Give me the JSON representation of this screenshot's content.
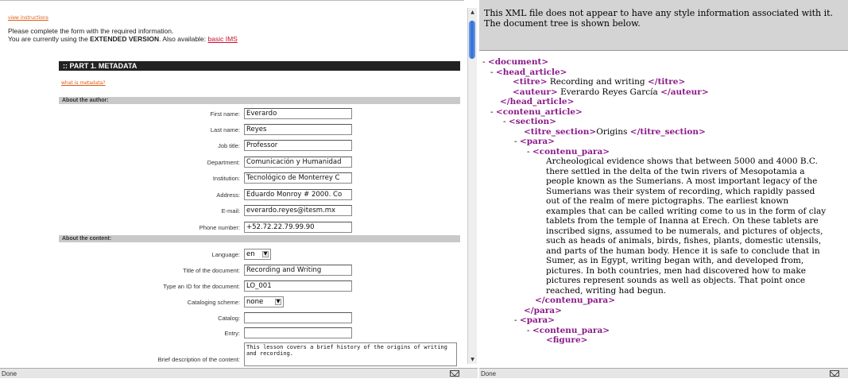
{
  "left": {
    "view_instructions": "view instructions",
    "intro_line1": "Please complete the form with the required information.",
    "intro_line2_prefix": "You are currently using the ",
    "intro_line2_version": "EXTENDED VERSION",
    "intro_line2_mid": ". Also available: ",
    "intro_line2_link": "basic IMS",
    "part_title": ":: PART 1. METADATA",
    "what_is_metadata": "what is metadata?",
    "section_author": "About the author:",
    "section_content": "About the content:",
    "author_fields": [
      {
        "label": "First name:",
        "value": "Everardo"
      },
      {
        "label": "Last name:",
        "value": "Reyes"
      },
      {
        "label": "Job title:",
        "value": "Professor"
      },
      {
        "label": "Department:",
        "value": "Comunicación y Humanidad"
      },
      {
        "label": "Institution:",
        "value": "Tecnológico de Monterrey C"
      },
      {
        "label": "Address:",
        "value": "Eduardo Monroy # 2000. Co"
      },
      {
        "label": "E-mail:",
        "value": "everardo.reyes@itesm.mx"
      },
      {
        "label": "Phone number:",
        "value": "+52.72.22.79.99.90"
      }
    ],
    "language_label": "Language:",
    "language_value": "en",
    "doc_title_label": "Title of the document:",
    "doc_title_value": "Recording and Writing",
    "id_label": "Type an ID for the document:",
    "id_value": "LO_001",
    "scheme_label": "Cataloging scheme:",
    "scheme_value": "none",
    "catalog_label": "Catalog:",
    "catalog_value": "",
    "entry_label": "Entry:",
    "entry_value": "",
    "desc_label": "Brief description of the content:",
    "desc_value": "This lesson covers a brief history of the origins of writing and recording.",
    "status": "Done"
  },
  "right": {
    "notice": "This XML file does not appear to have any style information associated with it. The document tree is shown below.",
    "status": "Done",
    "xml": {
      "minus": "-",
      "document_open": "<document>",
      "head_article_open": "<head_article>",
      "titre_open": "<titre>",
      "titre_text": " Recording and writing ",
      "titre_close": "</titre>",
      "auteur_open": "<auteur>",
      "auteur_text": " Everardo Reyes García ",
      "auteur_close": "</auteur>",
      "head_article_close": "</head_article>",
      "contenu_article_open": "<contenu_article>",
      "section_open": "<section>",
      "titre_section_open": "<titre_section>",
      "titre_section_text": "Origins ",
      "titre_section_close": "</titre_section>",
      "para_open": "<para>",
      "contenu_para_open": "<contenu_para>",
      "para_text": "Archeological evidence shows that between 5000 and 4000 B.C. there settled in the delta of the twin rivers of Mesopotamia a people known as the Sumerians. A most important legacy of the Sumerians was their system of recording, which rapidly passed out of the realm of mere pictographs. The earliest known examples that can be called writing come to us in the form of clay tablets from the temple of Inanna at Erech. On these tablets are inscribed signs, assumed to be numerals, and pictures of objects, such as heads of animals, birds, fishes, plants, domestic utensils, and parts of the human body. Hence it is safe to conclude that in Sumer, as in Egypt, writing began with, and developed from, pictures. In both countries, men had discovered how to make pictures represent sounds as well as objects. That point once reached, writing had begun.",
      "contenu_para_close": "</contenu_para>",
      "para_close": "</para>",
      "figure_open": "<figure>"
    }
  },
  "icons": {
    "scroll_up": "▲",
    "scroll_down": "▼",
    "select_arrow": "▼"
  }
}
